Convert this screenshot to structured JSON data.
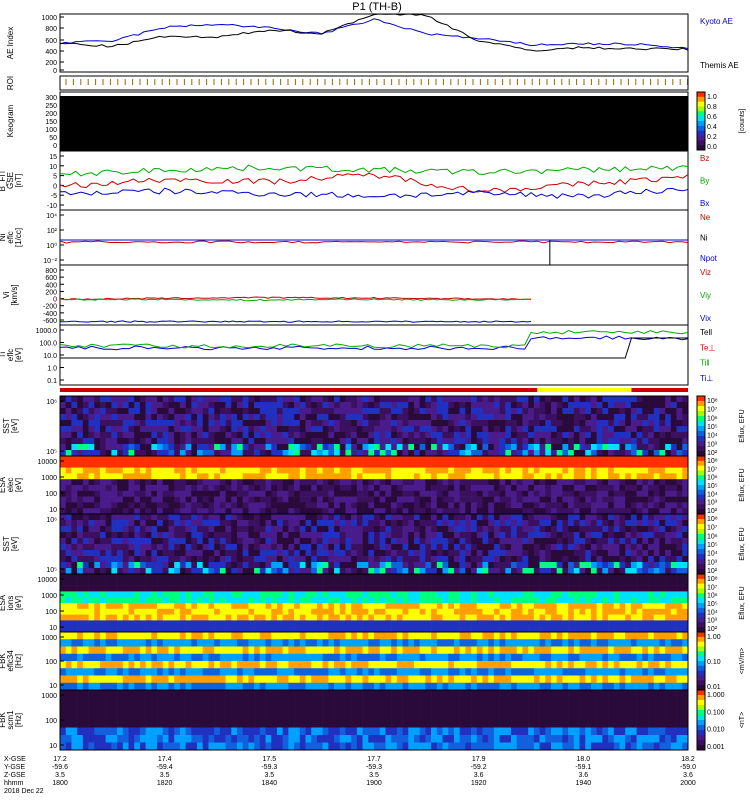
{
  "title": "P1 (TH-B)",
  "panels": [
    {
      "id": "ae",
      "ylabel": [
        "AE Index"
      ],
      "ticks": [
        "1000",
        "800",
        "600",
        "400",
        "200",
        "0"
      ],
      "legend": [
        {
          "text": "Kyoto AE",
          "color": "#0000cc"
        },
        {
          "text": "Themis AE",
          "color": "#000000"
        }
      ]
    },
    {
      "id": "roi",
      "ylabel": [
        "ROI"
      ],
      "ticks": []
    },
    {
      "id": "keogram",
      "ylabel": [
        "Keogram"
      ],
      "ticks": [
        "300",
        "250",
        "200",
        "150",
        "100",
        "50",
        "0"
      ]
    },
    {
      "id": "bfit",
      "ylabel": [
        "B_FIT",
        "GSE",
        "[nT]"
      ],
      "ticks": [
        "15",
        "10",
        "5",
        "0",
        "-5",
        "-10"
      ],
      "legend": [
        {
          "text": "Bz",
          "color": "#cc0000"
        },
        {
          "text": "By",
          "color": "#00aa00"
        },
        {
          "text": "Bx",
          "color": "#0000cc"
        }
      ]
    },
    {
      "id": "ni",
      "ylabel": [
        "Ni",
        "eflc",
        "[1/cc]"
      ],
      "ticks": [
        "10⁴",
        "10²",
        "10⁰",
        "10⁻²"
      ],
      "legend": [
        {
          "text": "Ne",
          "color": "#cc0000"
        },
        {
          "text": "Ni",
          "color": "#000000"
        },
        {
          "text": "Npot",
          "color": "#0000cc"
        }
      ]
    },
    {
      "id": "vi",
      "ylabel": [
        "Vi",
        "[km/s]"
      ],
      "ticks": [
        "800",
        "600",
        "400",
        "200",
        "0",
        "-200",
        "-400",
        "-600"
      ],
      "legend": [
        {
          "text": "Viz",
          "color": "#cc0000"
        },
        {
          "text": "Viy",
          "color": "#00aa00"
        },
        {
          "text": "Vix",
          "color": "#0000cc"
        }
      ]
    },
    {
      "id": "ti",
      "ylabel": [
        "Ti",
        "eflc",
        "[eV]"
      ],
      "ticks": [
        "1000.0",
        "100.0",
        "10.0",
        "1.0",
        "0.1"
      ],
      "legend": [
        {
          "text": "Tell",
          "color": "#000000"
        },
        {
          "text": "Te⊥",
          "color": "#cc0000"
        },
        {
          "text": "Ti‖",
          "color": "#00aa00"
        },
        {
          "text": "Ti⊥",
          "color": "#0000cc"
        }
      ]
    },
    {
      "id": "sst_e",
      "ylabel": [
        "SST",
        "[eV]"
      ],
      "ticks": [
        "10⁶",
        "10⁵"
      ]
    },
    {
      "id": "esa_e",
      "ylabel": [
        "ESA",
        "elec",
        "[eV]"
      ],
      "ticks": [
        "10000",
        "1000",
        "100",
        "10"
      ]
    },
    {
      "id": "sst_i",
      "ylabel": [
        "SST",
        "[eV]"
      ],
      "ticks": [
        "10⁶",
        "10⁵"
      ]
    },
    {
      "id": "esa_i",
      "ylabel": [
        "ESA",
        "ions",
        "[eV]"
      ],
      "ticks": [
        "10000",
        "1000",
        "100",
        "10"
      ]
    },
    {
      "id": "fbk1",
      "ylabel": [
        "FBK",
        "eflc34",
        "[Hz]"
      ],
      "ticks": [
        "1000",
        "100",
        "10"
      ]
    },
    {
      "id": "fbk2",
      "ylabel": [
        "FBK",
        "scm1",
        "[Hz]"
      ],
      "ticks": [
        "1000",
        "100",
        "10"
      ]
    }
  ],
  "colorbars": [
    {
      "label": "[counts]",
      "ticks": [
        "1.0",
        "0.8",
        "0.6",
        "0.4",
        "0.2",
        "0.0"
      ]
    },
    {
      "label": "Eflux, EFU",
      "ticks": [
        "10⁸",
        "10⁷",
        "10⁶",
        "10⁵",
        "10⁴",
        "10³",
        "10²"
      ]
    },
    {
      "label": "Eflux, EFU",
      "ticks": [
        "10⁸",
        "10⁷",
        "10⁶",
        "10⁵",
        "10⁴",
        "10³",
        "10²"
      ]
    },
    {
      "label": "Eflux, EFU",
      "ticks": [
        "10⁸",
        "10⁷",
        "10⁶",
        "10⁵",
        "10⁴",
        "10³",
        "10²"
      ]
    },
    {
      "label": "Eflux, EFU",
      "ticks": [
        "10⁸",
        "10⁷",
        "10⁶",
        "10⁵",
        "10⁴",
        "10³",
        "10²"
      ]
    },
    {
      "label": "<mV/m>",
      "ticks": [
        "1.00",
        "0.10",
        "0.01"
      ]
    },
    {
      "label": "<nT>",
      "ticks": [
        "1.000",
        "0.100",
        "0.010",
        "0.001"
      ]
    }
  ],
  "xaxis": {
    "row_labels": [
      "X-GSE",
      "Y-GSE",
      "Z-GSE",
      "hhmm",
      "2018 Dec 22"
    ],
    "columns": [
      [
        "17.2",
        "-59.6",
        "3.5",
        "1800"
      ],
      [
        "17.4",
        "-59.4",
        "3.5",
        "1820"
      ],
      [
        "17.5",
        "-59.3",
        "3.5",
        "1840"
      ],
      [
        "17.7",
        "-59.3",
        "3.5",
        "1900"
      ],
      [
        "17.9",
        "-59.2",
        "3.6",
        "1920"
      ],
      [
        "18.0",
        "-59.1",
        "3.6",
        "1940"
      ],
      [
        "18.2",
        "-59.0",
        "3.6",
        "2000"
      ]
    ]
  },
  "chart_data": [
    {
      "type": "line",
      "title": "AE Index",
      "x": [
        "1800",
        "1810",
        "1820",
        "1830",
        "1840",
        "1850",
        "1900",
        "1910",
        "1920",
        "1930",
        "1940",
        "1950",
        "2000"
      ],
      "series": [
        {
          "name": "Kyoto AE",
          "values": [
            480,
            520,
            760,
            820,
            750,
            650,
            900,
            650,
            560,
            450,
            470,
            460,
            380
          ]
        },
        {
          "name": "Themis AE",
          "values": [
            480,
            420,
            600,
            580,
            720,
            650,
            1000,
            980,
            520,
            350,
            400,
            380,
            370
          ]
        }
      ],
      "ylim": [
        0,
        1000
      ]
    },
    {
      "type": "line",
      "title": "B_FIT GSE [nT]",
      "x": [
        "1800",
        "1820",
        "1840",
        "1900",
        "1920",
        "1940",
        "2000"
      ],
      "series": [
        {
          "name": "Bz",
          "values": [
            0,
            3,
            2,
            5,
            -2,
            1,
            4
          ]
        },
        {
          "name": "By",
          "values": [
            5,
            7,
            8,
            7,
            6,
            7,
            8
          ]
        },
        {
          "name": "Bx",
          "values": [
            -3,
            -2,
            -3,
            -4,
            -3,
            -4,
            -1
          ]
        }
      ],
      "ylim": [
        -10,
        15
      ]
    },
    {
      "type": "line",
      "title": "Vi [km/s]",
      "x": [
        "1800",
        "1820",
        "1840",
        "1900",
        "1920",
        "1931"
      ],
      "series": [
        {
          "name": "Viz",
          "values": [
            0,
            20,
            40,
            30,
            20,
            0
          ]
        },
        {
          "name": "Viy",
          "values": [
            -10,
            0,
            -20,
            0,
            -10,
            -10
          ]
        },
        {
          "name": "Vix",
          "values": [
            -520,
            -520,
            -520,
            -520,
            -520,
            -520
          ]
        }
      ],
      "ylim": [
        -600,
        800
      ]
    }
  ]
}
